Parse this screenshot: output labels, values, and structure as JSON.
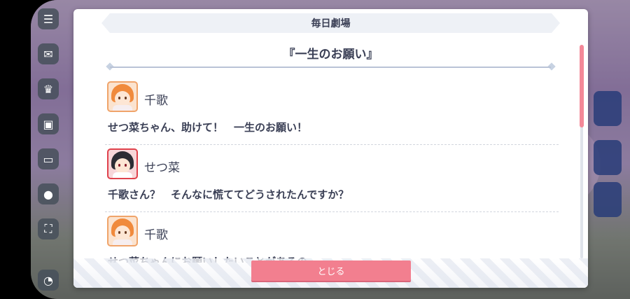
{
  "dialog": {
    "header": "毎日劇場",
    "story_title": "『一生のお願い』",
    "lines": [
      {
        "speaker": "千歌",
        "text": "せつ菜ちゃん、助けて！　一生のお願い！",
        "avatar": "chika-avatar"
      },
      {
        "speaker": "せつ菜",
        "text": "千歌さん？　そんなに慌ててどうされたんですか？",
        "avatar": "setsuna-avatar"
      },
      {
        "speaker": "千歌",
        "text": "せつ菜ちゃんにお願いしたいことがあるの",
        "avatar": "chika-avatar"
      }
    ],
    "close_label": "とじる"
  },
  "colors": {
    "accent": "#f27f8f",
    "text": "#3a3f55",
    "chika_border": "#f0a46a",
    "setsuna_border": "#e0424c"
  }
}
